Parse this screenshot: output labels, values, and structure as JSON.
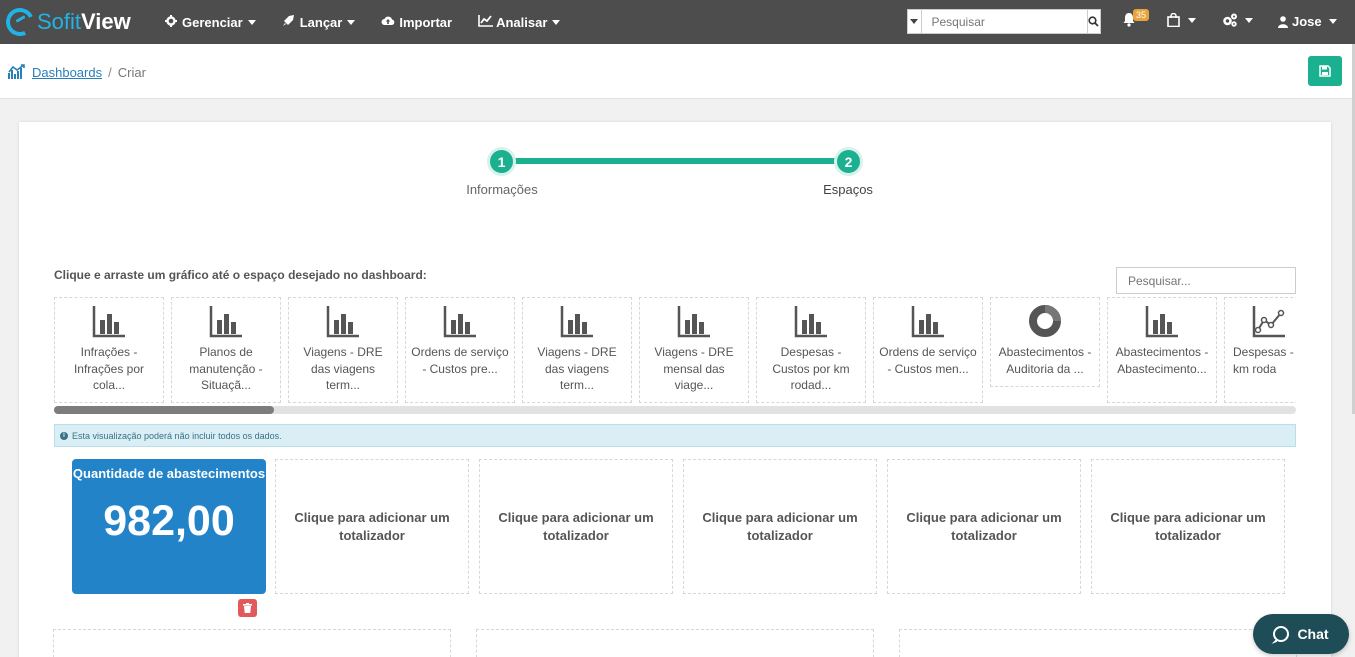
{
  "brand": {
    "part1": "Sofit",
    "part2": "View"
  },
  "nav": {
    "items": [
      {
        "label": "Gerenciar",
        "icon": "gear-icon",
        "dropdown": true
      },
      {
        "label": "Lançar",
        "icon": "rocket-icon",
        "dropdown": true
      },
      {
        "label": "Importar",
        "icon": "cloud-upload-icon",
        "dropdown": false
      },
      {
        "label": "Analisar",
        "icon": "line-chart-icon",
        "dropdown": true
      }
    ],
    "search_placeholder": "Pesquisar",
    "notifications_count": "35",
    "user": "Jose"
  },
  "breadcrumb": {
    "parent": "Dashboards",
    "separator": "/",
    "current": "Criar"
  },
  "steps": [
    {
      "number": "1",
      "label": "Informações"
    },
    {
      "number": "2",
      "label": "Espaços"
    }
  ],
  "instruction": "Clique e arraste um gráfico até o espaço desejado no dashboard:",
  "gallery_search_placeholder": "Pesquisar...",
  "charts": [
    {
      "label": "Infrações - Infrações por cola...",
      "icon": "bar-chart-icon"
    },
    {
      "label": "Planos de manutenção - Situaçã...",
      "icon": "bar-chart-icon"
    },
    {
      "label": "Viagens - DRE das viagens term...",
      "icon": "bar-chart-icon"
    },
    {
      "label": "Ordens de serviço - Custos pre...",
      "icon": "bar-chart-icon"
    },
    {
      "label": "Viagens - DRE das viagens term...",
      "icon": "bar-chart-icon"
    },
    {
      "label": "Viagens - DRE mensal das viage...",
      "icon": "bar-chart-icon"
    },
    {
      "label": "Despesas - Custos por km rodad...",
      "icon": "bar-chart-icon"
    },
    {
      "label": "Ordens de serviço - Custos men...",
      "icon": "bar-chart-icon"
    },
    {
      "label": "Abastecimentos - Auditoria da ...",
      "icon": "donut-chart-icon"
    },
    {
      "label": "Abastecimentos - Abastecimento...",
      "icon": "bar-chart-icon"
    },
    {
      "label": "Despesas - C por km roda",
      "icon": "line-chart-icon"
    }
  ],
  "alert": "Esta visualização poderá não incluir todos os dados.",
  "totalizer_filled": {
    "title": "Quantidade de abastecimentos",
    "value": "982,00"
  },
  "totalizer_empty_label": "Clique para adicionar um totalizador",
  "chat_label": "Chat",
  "colors": {
    "nav": "#4e4d4d",
    "accent": "#1bb08f",
    "primary": "#2283c9",
    "danger": "#e0595b",
    "brand": "#22b3e6"
  }
}
